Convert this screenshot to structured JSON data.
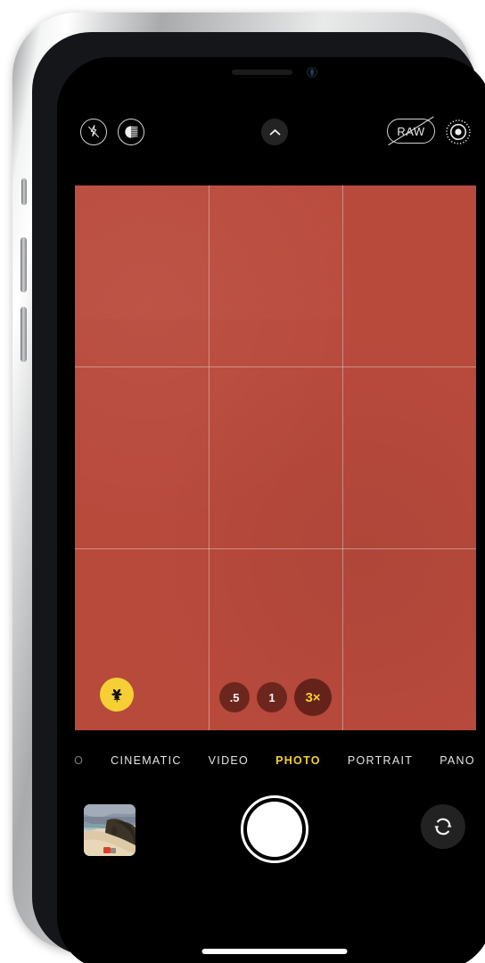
{
  "device": {
    "name": "iphone-camera-app",
    "frame_color": "#c9cacb",
    "screen_background": "#000000"
  },
  "top_controls": {
    "flash": {
      "icon": "flash-off-icon",
      "state": "off"
    },
    "photographic_styles": {
      "icon": "photographic-styles-icon",
      "state": "on"
    },
    "expand": {
      "icon": "chevron-up-icon",
      "label": ""
    },
    "raw": {
      "label": "RAW",
      "icon": "raw-off-icon",
      "state": "off"
    },
    "live_photo": {
      "icon": "live-photo-icon",
      "state": "on"
    }
  },
  "viewfinder": {
    "subject_color": "#b84a3c",
    "grid": "rule-of-thirds",
    "grid_visible": true,
    "macro": {
      "icon": "macro-flower-icon",
      "state": "on",
      "accent": "#f5cf34"
    }
  },
  "zoom_levels": {
    "options": [
      {
        "label": ".5",
        "selected": false
      },
      {
        "label": "1",
        "selected": false
      },
      {
        "label": "3×",
        "selected": true
      }
    ],
    "selected_color": "#f5cf34"
  },
  "mode_selector": {
    "modes": [
      {
        "label": "O",
        "selected": false,
        "clipped": true
      },
      {
        "label": "CINEMATIC",
        "selected": false
      },
      {
        "label": "VIDEO",
        "selected": false
      },
      {
        "label": "PHOTO",
        "selected": true
      },
      {
        "label": "PORTRAIT",
        "selected": false
      },
      {
        "label": "PANO",
        "selected": false
      }
    ],
    "active_color": "#f5cf34"
  },
  "bottom_controls": {
    "thumbnail": {
      "name": "last-photo-thumbnail",
      "description": "beach with cliff"
    },
    "shutter": {
      "name": "shutter-button",
      "color": "#ffffff"
    },
    "flip_camera": {
      "icon": "camera-flip-icon"
    }
  },
  "system": {
    "home_indicator": true
  }
}
